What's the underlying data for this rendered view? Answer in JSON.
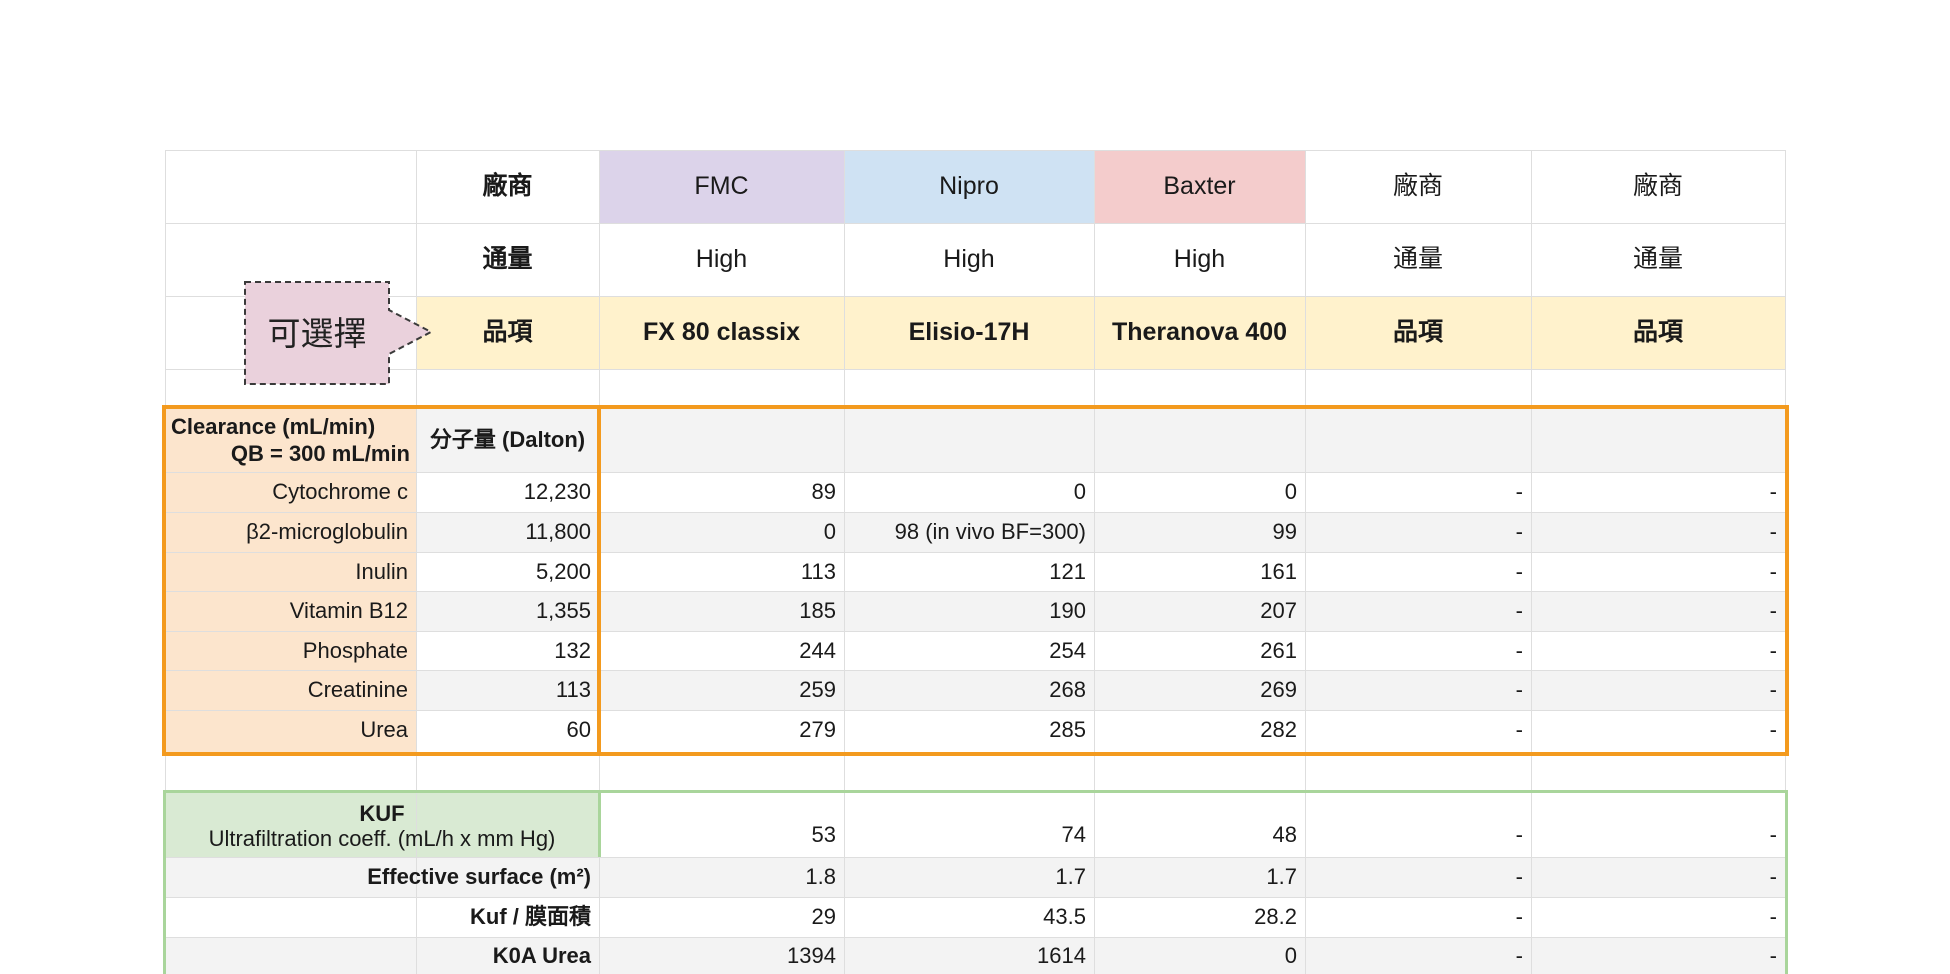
{
  "header": {
    "row1": [
      "廠商",
      "FMC",
      "Nipro",
      "Baxter",
      "廠商",
      "廠商"
    ],
    "row2": [
      "通量",
      "High",
      "High",
      "High",
      "通量",
      "通量"
    ],
    "row3": [
      "品項",
      "FX 80 classix",
      "Elisio-17H",
      "Theranova 400",
      "品項",
      "品項"
    ],
    "callout": "可選擇"
  },
  "clearance": {
    "title_line1": "Clearance  (mL/min)",
    "title_line2": "QB = 300 mL/min",
    "mw_header": "分子量 (Dalton)",
    "rows": [
      {
        "name": "Cytochrome c",
        "mw": "12,230",
        "fmc": "89",
        "nipro": "0",
        "baxter": "0",
        "v4": "-",
        "v5": "-"
      },
      {
        "name": "β2-microglobulin",
        "mw": "11,800",
        "fmc": "0",
        "nipro": "98 (in vivo BF=300)",
        "baxter": "99",
        "v4": "-",
        "v5": "-"
      },
      {
        "name": "Inulin",
        "mw": "5,200",
        "fmc": "113",
        "nipro": "121",
        "baxter": "161",
        "v4": "-",
        "v5": "-"
      },
      {
        "name": "Vitamin B12",
        "mw": "1,355",
        "fmc": "185",
        "nipro": "190",
        "baxter": "207",
        "v4": "-",
        "v5": "-"
      },
      {
        "name": "Phosphate",
        "mw": "132",
        "fmc": "244",
        "nipro": "254",
        "baxter": "261",
        "v4": "-",
        "v5": "-"
      },
      {
        "name": "Creatinine",
        "mw": "113",
        "fmc": "259",
        "nipro": "268",
        "baxter": "269",
        "v4": "-",
        "v5": "-"
      },
      {
        "name": "Urea",
        "mw": "60",
        "fmc": "279",
        "nipro": "285",
        "baxter": "282",
        "v4": "-",
        "v5": "-"
      }
    ]
  },
  "kuf": {
    "title": "KUF",
    "subtitle": "Ultrafiltration coeff. (mL/h x mm Hg)",
    "kuf_values": [
      "53",
      "74",
      "48",
      "-",
      "-"
    ],
    "surface_label": "Effective surface (m²)",
    "surface_values": [
      "1.8",
      "1.7",
      "1.7",
      "-",
      "-"
    ],
    "ratio_label": "Kuf / 膜面積",
    "ratio_values": [
      "29",
      "43.5",
      "28.2",
      "-",
      "-"
    ],
    "k0a_label": "K0A Urea",
    "k0a_values": [
      "1394",
      "1614",
      "0",
      "-",
      "-"
    ]
  },
  "colors": {
    "fmc": "#dcd3ea",
    "nipro": "#cfe2f3",
    "baxter": "#f4cccc",
    "item_row": "#fff2cc",
    "clearance_label": "#fce5cd",
    "orange_border": "#f39a1e",
    "green_label": "#d9ead3",
    "green_border": "#a9d59b",
    "callout_fill": "#ead1dc"
  }
}
